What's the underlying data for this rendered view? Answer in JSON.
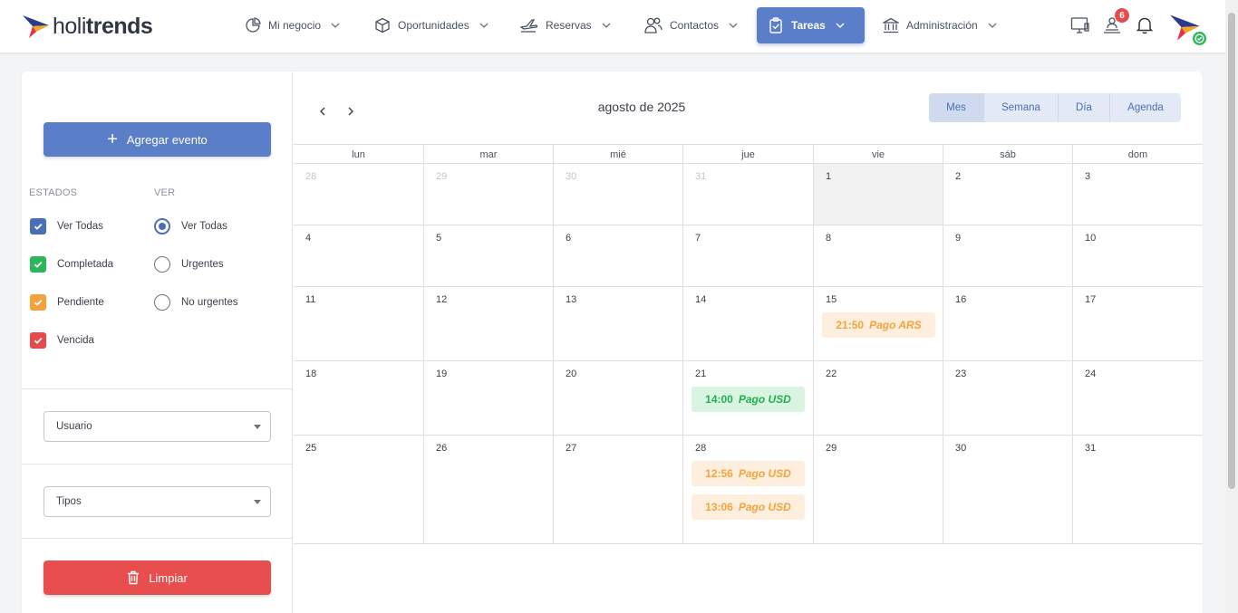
{
  "brand": {
    "name_light": "holi",
    "name_bold": "trends"
  },
  "nav": [
    {
      "label": "Mi negocio",
      "icon": "pie-chart-icon"
    },
    {
      "label": "Oportunidades",
      "icon": "box-icon"
    },
    {
      "label": "Reservas",
      "icon": "plane-icon"
    },
    {
      "label": "Contactos",
      "icon": "users-icon"
    },
    {
      "label": "Tareas",
      "icon": "clipboard-check-icon",
      "active": true
    },
    {
      "label": "Administración",
      "icon": "bank-icon"
    }
  ],
  "topbar": {
    "notifications_badge": "6"
  },
  "sidebar": {
    "add_event_label": "Agregar evento",
    "states_title": "ESTADOS",
    "view_title": "VER",
    "states": [
      {
        "label": "Ver Todas",
        "color": "#4a6fb8"
      },
      {
        "label": "Completada",
        "color": "#2db75b"
      },
      {
        "label": "Pendiente",
        "color": "#f5a13c"
      },
      {
        "label": "Vencida",
        "color": "#e84a4a"
      }
    ],
    "views": [
      {
        "label": "Ver Todas",
        "selected": true
      },
      {
        "label": "Urgentes",
        "selected": false
      },
      {
        "label": "No urgentes",
        "selected": false
      }
    ],
    "user_select": "Usuario",
    "types_select": "Tipos",
    "clear_label": "Limpiar"
  },
  "calendar": {
    "title": "agosto de 2025",
    "views": [
      "Mes",
      "Semana",
      "Día",
      "Agenda"
    ],
    "active_view": "Mes",
    "weekdays": [
      "lun",
      "mar",
      "mié",
      "jue",
      "vie",
      "sáb",
      "dom"
    ],
    "weeks": [
      [
        "28",
        "29",
        "30",
        "31",
        "1",
        "2",
        "3"
      ],
      [
        "4",
        "5",
        "6",
        "7",
        "8",
        "9",
        "10"
      ],
      [
        "11",
        "12",
        "13",
        "14",
        "15",
        "16",
        "17"
      ],
      [
        "18",
        "19",
        "20",
        "21",
        "22",
        "23",
        "24"
      ],
      [
        "25",
        "26",
        "27",
        "28",
        "29",
        "30",
        "31"
      ]
    ],
    "today": "1",
    "events": [
      {
        "week": 2,
        "day": 4,
        "time": "21:50",
        "title": "Pago ARS",
        "status": "pendiente"
      },
      {
        "week": 3,
        "day": 3,
        "time": "14:00",
        "title": "Pago USD",
        "status": "completada"
      },
      {
        "week": 4,
        "day": 3,
        "time": "12:56",
        "title": "Pago USD",
        "status": "pendiente"
      },
      {
        "week": 4,
        "day": 3,
        "time": "13:06",
        "title": "Pago USD",
        "status": "pendiente"
      }
    ]
  }
}
